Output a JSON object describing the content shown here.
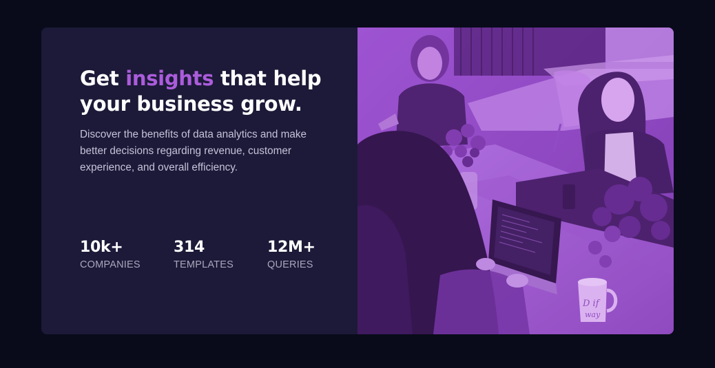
{
  "hero": {
    "headline_prefix": "Get ",
    "headline_accent": "insights",
    "headline_suffix": " that help your business grow.",
    "description": "Discover the benefits of data analytics and make better decisions regarding revenue, customer experience, and overall efficiency."
  },
  "stats": [
    {
      "value": "10k+",
      "label": "COMPANIES"
    },
    {
      "value": "314",
      "label": "TEMPLATES"
    },
    {
      "value": "12M+",
      "label": "QUERIES"
    }
  ],
  "image": {
    "subject": "office-team-working",
    "tint": "#aa5cdb",
    "mug_text": "D if way"
  },
  "colors": {
    "page_bg": "#090b1a",
    "card_bg": "#1c1a38",
    "accent": "#ab5cdb"
  }
}
